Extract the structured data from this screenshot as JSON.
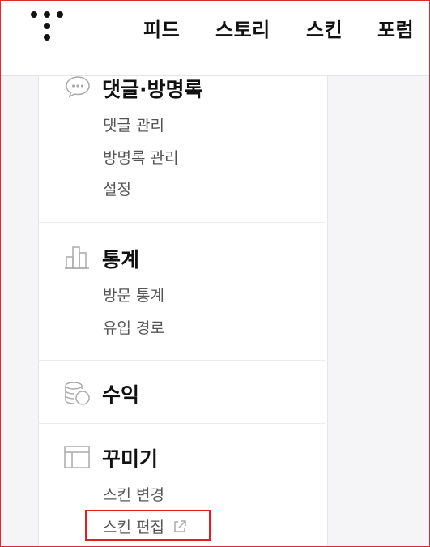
{
  "header": {
    "nav": [
      {
        "label": "피드"
      },
      {
        "label": "스토리"
      },
      {
        "label": "스킨"
      },
      {
        "label": "포럼"
      }
    ]
  },
  "sidebar": {
    "sections": [
      {
        "icon": "speech-bubble-icon",
        "title": "댓글·방명록",
        "items": [
          {
            "label": "댓글 관리"
          },
          {
            "label": "방명록 관리"
          },
          {
            "label": "설정"
          }
        ]
      },
      {
        "icon": "bar-chart-icon",
        "title": "통계",
        "items": [
          {
            "label": "방문 통계"
          },
          {
            "label": "유입 경로"
          }
        ]
      },
      {
        "icon": "coins-icon",
        "title": "수익",
        "items": []
      },
      {
        "icon": "layout-icon",
        "title": "꾸미기",
        "items": [
          {
            "label": "스킨 변경"
          },
          {
            "label": "스킨 편집",
            "icon": "external-link-icon"
          }
        ]
      }
    ]
  },
  "colors": {
    "highlight": "#e02020",
    "frame": "#d32f2f",
    "icon_gray": "#aaaaaa"
  }
}
